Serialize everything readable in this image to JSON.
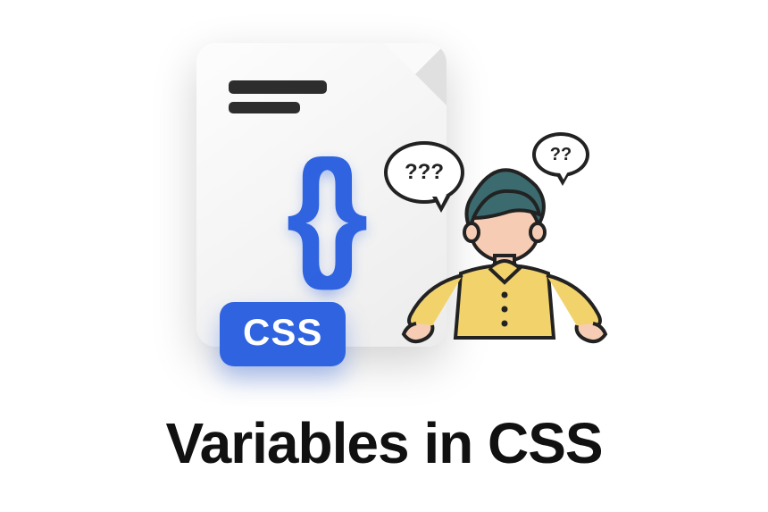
{
  "title": "Variables in CSS",
  "file": {
    "badge": "CSS",
    "brace_left": "{",
    "brace_right": "}"
  },
  "bubbles": {
    "big": "???",
    "small": "??"
  }
}
